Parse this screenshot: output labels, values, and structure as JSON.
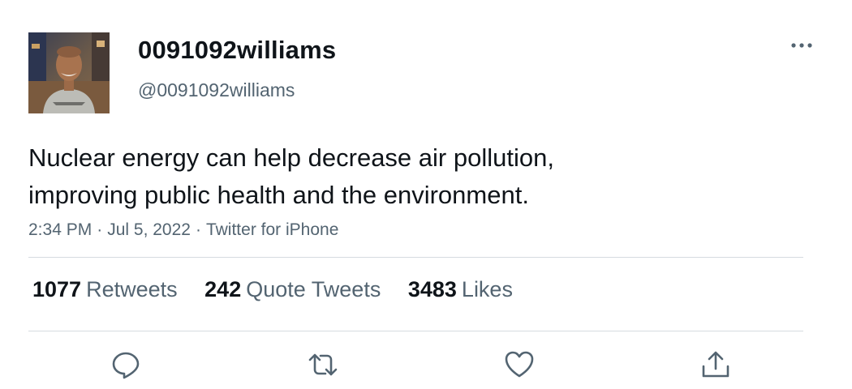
{
  "tweet": {
    "display_name": "0091092williams",
    "handle": "@0091092williams",
    "text_lines": [
      "Nuclear energy can help decrease air pollution,",
      "improving public health and the environment."
    ],
    "time": "2:34 PM",
    "date": "Jul 5, 2022",
    "source": "Twitter for iPhone",
    "separator": "·"
  },
  "stats": {
    "retweets": {
      "count": "1077",
      "label": "Retweets"
    },
    "quotes": {
      "count": "242",
      "label": "Quote Tweets"
    },
    "likes": {
      "count": "3483",
      "label": "Likes"
    }
  },
  "icons": {
    "more": "more-horizontal-icon",
    "reply": "reply-icon",
    "retweet": "retweet-icon",
    "like": "heart-icon",
    "share": "share-icon"
  },
  "colors": {
    "text_primary": "#0f1419",
    "text_secondary": "#536471",
    "divider": "#d5dbe0",
    "icon": "#536471"
  }
}
